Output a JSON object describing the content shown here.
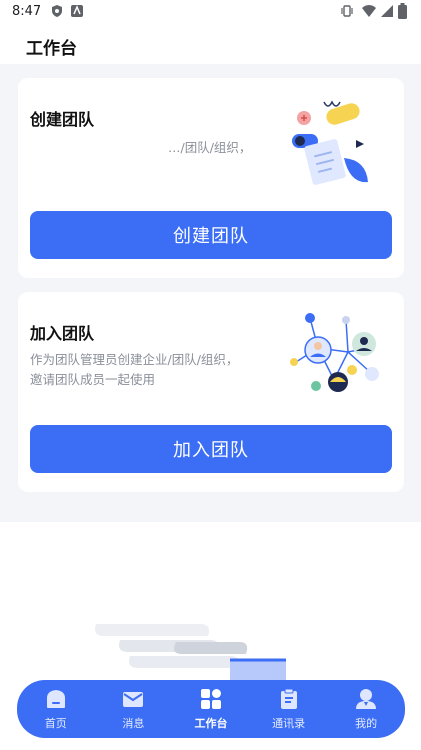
{
  "status_bar": {
    "time": "8:47"
  },
  "header": {
    "title": "工作台"
  },
  "cards": {
    "create": {
      "title": "创建团队",
      "description": "…/团队/组织，",
      "button_label": "创建团队"
    },
    "join": {
      "title": "加入团队",
      "description_line1": "作为团队管理员创建企业/团队/组织，",
      "description_line2": "邀请团队成员一起使用",
      "button_label": "加入团队"
    }
  },
  "bottom_nav": {
    "items": [
      {
        "label": "首页",
        "icon": "home-icon"
      },
      {
        "label": "消息",
        "icon": "mail-icon"
      },
      {
        "label": "工作台",
        "icon": "grid-icon",
        "active": true
      },
      {
        "label": "通讯录",
        "icon": "clipboard-icon"
      },
      {
        "label": "我的",
        "icon": "person-icon"
      }
    ]
  },
  "colors": {
    "accent": "#3b6ef5",
    "background": "#f3f5f8"
  }
}
